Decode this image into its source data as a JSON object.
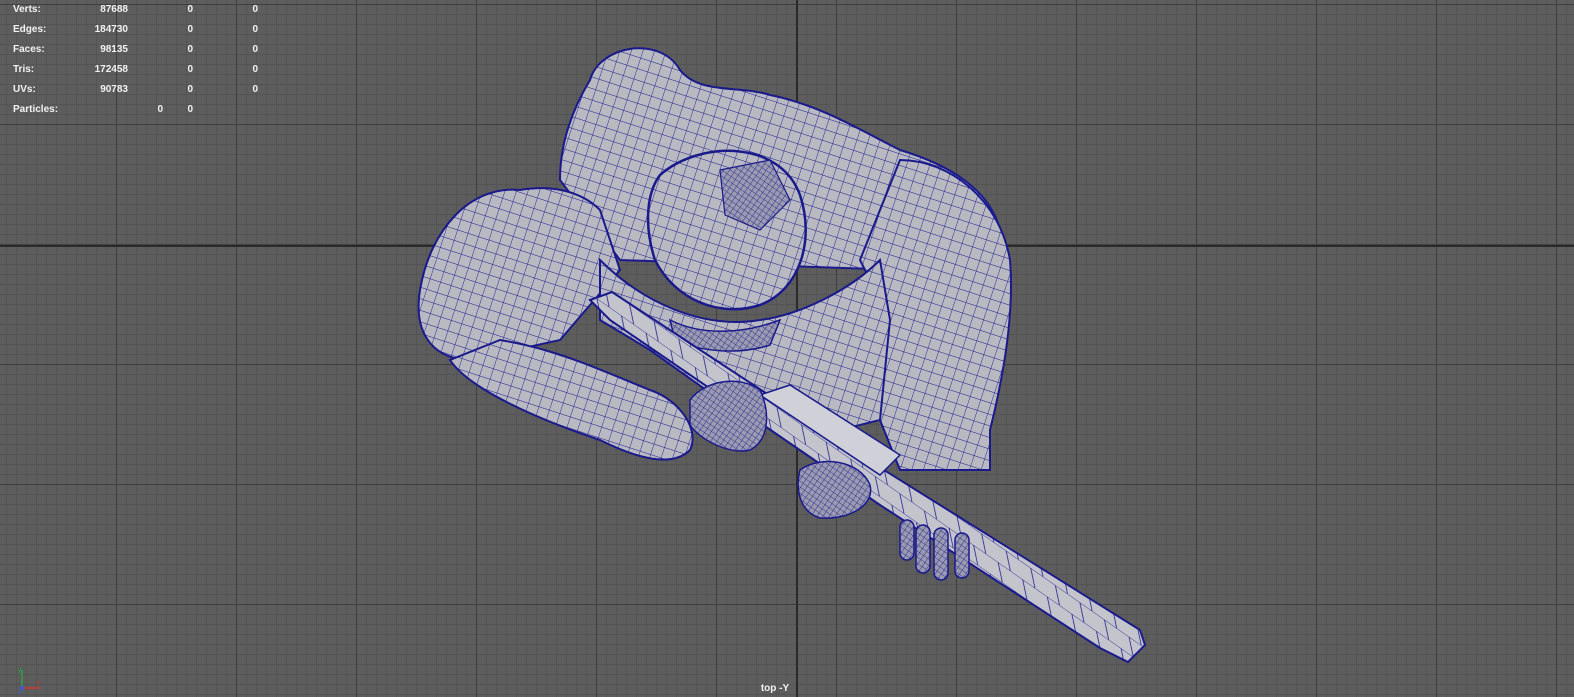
{
  "hud": {
    "rows": [
      {
        "label": "Verts:",
        "v1": "87688",
        "v2": "0",
        "v3": "0"
      },
      {
        "label": "Edges:",
        "v1": "184730",
        "v2": "0",
        "v3": "0"
      },
      {
        "label": "Faces:",
        "v1": "98135",
        "v2": "0",
        "v3": "0"
      },
      {
        "label": "Tris:",
        "v1": "172458",
        "v2": "0",
        "v3": "0"
      },
      {
        "label": "UVs:",
        "v1": "90783",
        "v2": "0",
        "v3": "0"
      }
    ],
    "particles": {
      "label": "Particles:",
      "v1": "0",
      "v2": "0"
    }
  },
  "viewport": {
    "camera_label": "top -Y",
    "axis_indicator": {
      "y_label": "y",
      "x_label": "x",
      "z_label": "z"
    },
    "colors": {
      "background": "#5d5d5d",
      "grid_major": "#3f3f3f",
      "grid_minor": "#545454",
      "wireframe": "#1a1a8c",
      "mesh_fill": "#b9b9c2",
      "axis_y": "#2ea043",
      "axis_x": "#d0342c",
      "axis_z": "#3a5fd0"
    },
    "icons": [
      "view-axis-icon"
    ]
  }
}
